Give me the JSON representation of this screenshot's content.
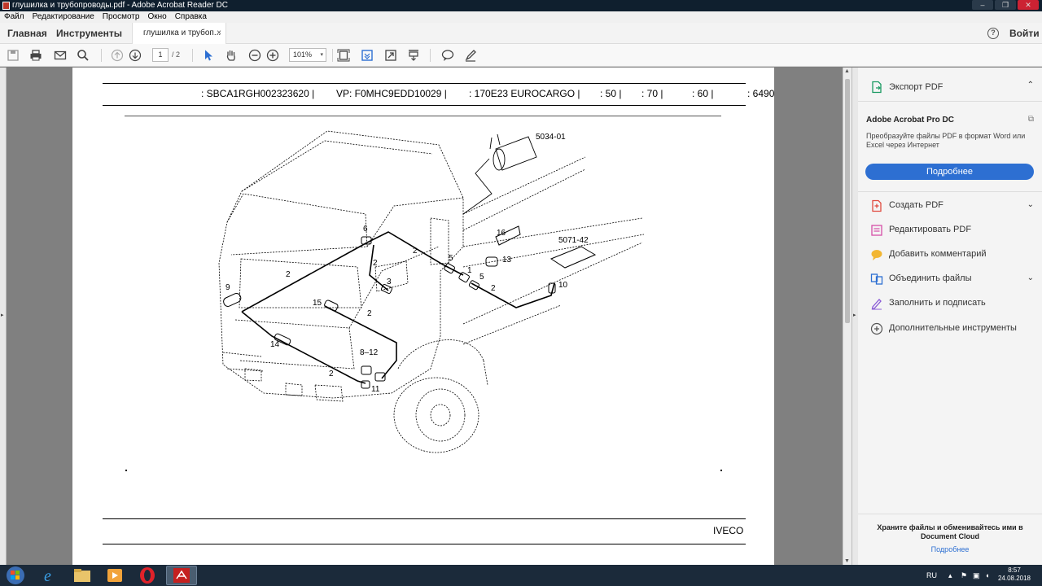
{
  "window": {
    "title": "глушилка и трубопроводы.pdf - Adobe Acrobat Reader DC",
    "minimize": "–",
    "maximize": "❐",
    "close": "✕"
  },
  "menu": [
    "Файл",
    "Редактирование",
    "Просмотр",
    "Окно",
    "Справка"
  ],
  "nav": {
    "home": "Главная",
    "tools": "Инструменты",
    "tab_label": "глушилка и трубоп...",
    "tab_close": "×",
    "help": "?",
    "signin": "Войти"
  },
  "toolbar": {
    "page_current": "1",
    "page_total": "/ 2",
    "zoom": "101%",
    "zoom_caret": "▾"
  },
  "document": {
    "header_cells": [
      ": SBCA1RGH002323620 |",
      "VP: F0MHC9EDD10029 |",
      ": 170E23 EUROCARGO |",
      ": 50 |",
      ": 70 |",
      ": 60 |",
      ": 6490"
    ],
    "footer_brand": "IVECO",
    "drawing": {
      "codes": [
        "5034-01",
        "5071-42"
      ],
      "callouts": [
        "1",
        "2",
        "2",
        "2",
        "2",
        "2",
        "2",
        "3",
        "5",
        "5",
        "6",
        "8–12",
        "9",
        "10",
        "11",
        "13",
        "14",
        "15",
        "16"
      ]
    }
  },
  "right_pane": {
    "export_pdf": "Экспорт PDF",
    "pro_title": "Adobe Acrobat Pro DC",
    "pro_desc": "Преобразуйте файлы PDF в формат Word или Excel через Интернет",
    "pro_button": "Подробнее",
    "tools": [
      {
        "label": "Создать PDF",
        "icon": "create-pdf-icon",
        "color": "#e04a3f",
        "chevron": true
      },
      {
        "label": "Редактировать PDF",
        "icon": "edit-pdf-icon",
        "color": "#d64fa8",
        "chevron": false
      },
      {
        "label": "Добавить комментарий",
        "icon": "comment-icon",
        "color": "#f2b632",
        "chevron": false
      },
      {
        "label": "Объединить файлы",
        "icon": "combine-icon",
        "color": "#2d6fd2",
        "chevron": true
      },
      {
        "label": "Заполнить и подписать",
        "icon": "fill-sign-icon",
        "color": "#8a5bd6",
        "chevron": false
      },
      {
        "label": "Дополнительные инструменты",
        "icon": "more-tools-icon",
        "color": "#555555",
        "chevron": false
      }
    ],
    "chevron_up": "⌃",
    "chevron_down": "⌄",
    "cloud_text": "Храните файлы и обменивайтесь ими в Document Cloud",
    "cloud_link": "Подробнее"
  },
  "taskbar": {
    "language": "RU",
    "time": "8:57",
    "date": "24.08.2018"
  },
  "colors": {
    "accent": "#2d6fd2",
    "taskbar": "#1b2a3a"
  }
}
